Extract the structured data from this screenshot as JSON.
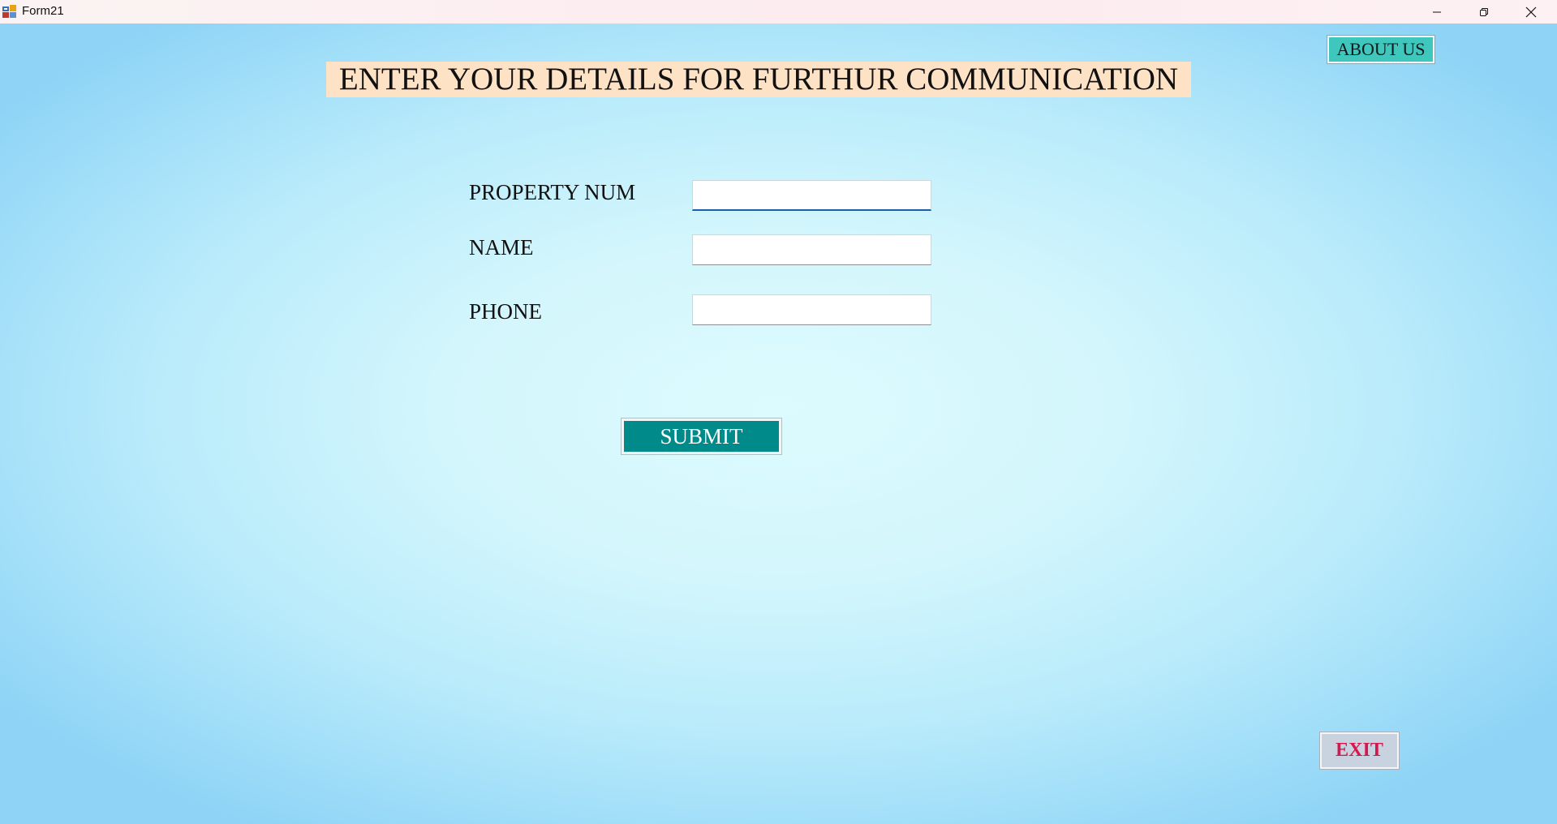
{
  "window": {
    "title": "Form21",
    "controls": {
      "minimize": "minimize-icon",
      "maximize": "restore-icon",
      "close": "close-icon"
    }
  },
  "form": {
    "heading": "ENTER YOUR DETAILS FOR FURTHUR COMMUNICATION",
    "about_label": "ABOUT US",
    "fields": {
      "property_num": {
        "label": "PROPERTY NUM",
        "value": ""
      },
      "name": {
        "label": "NAME",
        "value": ""
      },
      "phone": {
        "label": "PHONE",
        "value": ""
      }
    },
    "submit_label": "SUBMIT",
    "exit_label": "EXIT"
  },
  "colors": {
    "heading_bg": "#fde2c6",
    "about_bg": "#40c7bd",
    "submit_bg": "#008a8a",
    "exit_text": "#d6164c",
    "exit_bg": "#c9d3df",
    "focus_underline": "#1c5ea8"
  }
}
